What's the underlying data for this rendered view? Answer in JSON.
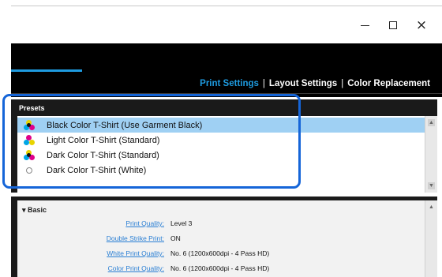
{
  "window": {
    "minimize_glyph": "",
    "maximize_glyph": "",
    "close_glyph": "×"
  },
  "nav": {
    "tabs": [
      {
        "label": "Print Settings",
        "active": true
      },
      {
        "label": "Layout Settings",
        "active": false
      },
      {
        "label": "Color Replacement",
        "active": false
      }
    ],
    "separator": "|"
  },
  "presets": {
    "heading": "Presets",
    "items": [
      {
        "label": "Black Color T-Shirt (Use Garment Black)",
        "icon": "cmyk-dots-icon",
        "selected": true
      },
      {
        "label": "Light Color T-Shirt (Standard)",
        "icon": "cmy-dots-icon",
        "selected": false
      },
      {
        "label": "Dark Color T-Shirt (Standard)",
        "icon": "cmyk-dots-icon",
        "selected": false
      },
      {
        "label": "Dark Color T-Shirt (White)",
        "icon": "empty-circle-icon",
        "selected": false
      }
    ]
  },
  "basic": {
    "heading": "▾ Basic",
    "settings": [
      {
        "label": "Print Quality:",
        "value": "Level 3"
      },
      {
        "label": "Double Strike Print:",
        "value": "ON"
      },
      {
        "label": "White Print Quality:",
        "value": "No. 6 (1200x600dpi - 4 Pass HD)"
      },
      {
        "label": "Color Print Quality:",
        "value": "No. 6 (1200x600dpi - 4 Pass HD)"
      }
    ]
  },
  "colors": {
    "accent": "#1e9be0",
    "selected_row": "#9fd0f3",
    "highlight_frame": "#1565d8",
    "link": "#2a7fd4"
  }
}
